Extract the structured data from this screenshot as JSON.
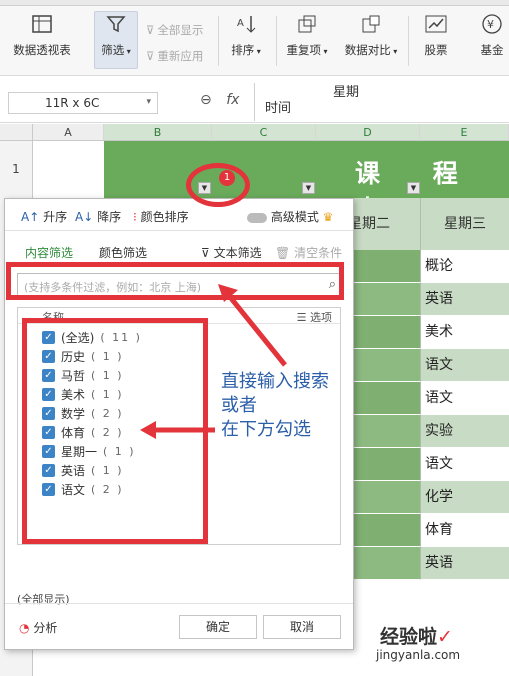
{
  "ribbon": {
    "pivot_label": "数据透视表",
    "filter_label": "筛选",
    "show_all_label": "全部显示",
    "reapply_label": "重新应用",
    "sort_label": "排序",
    "duplicates_label": "重复项",
    "compare_label": "数据对比",
    "stock_label": "股票",
    "fund_label": "基金"
  },
  "formula_bar": {
    "name_box": "11R x 6C",
    "fx_symbol": "fx",
    "content_line1": "星期",
    "content_line2": "时间"
  },
  "columns": [
    "A",
    "B",
    "C",
    "D",
    "E"
  ],
  "rows": [
    "1"
  ],
  "sheet": {
    "title": "课 程 表",
    "header_col_d": "星期二",
    "header_col_e": "星期三",
    "col_e_values": [
      "概论",
      "英语",
      "美术",
      "语文",
      "语文",
      "实验",
      "语文",
      "化学",
      "体育",
      "英语"
    ]
  },
  "panel": {
    "sort_asc": "升序",
    "sort_desc": "降序",
    "color_sort": "颜色排序",
    "advanced_mode": "高级模式",
    "tab_content": "内容筛选",
    "tab_color": "颜色筛选",
    "text_filter": "文本筛选",
    "clear_conditions": "清空条件",
    "search_placeholder": "(支持多条件过滤，例如：北京 上海)",
    "list_header_name": "名称",
    "list_header_options": "选项",
    "items": [
      {
        "label": "(全选)",
        "count": "( 11 )"
      },
      {
        "label": "历史",
        "count": "( 1 )"
      },
      {
        "label": "马哲",
        "count": "( 1 )"
      },
      {
        "label": "美术",
        "count": "( 1 )"
      },
      {
        "label": "数学",
        "count": "( 2 )"
      },
      {
        "label": "体育",
        "count": "( 2 )"
      },
      {
        "label": "星期一",
        "count": "( 1 )"
      },
      {
        "label": "英语",
        "count": "( 1 )"
      },
      {
        "label": "语文",
        "count": "( 2 )"
      }
    ],
    "show_all_status": "(全部显示)",
    "analysis": "分析",
    "ok": "确定",
    "cancel": "取消"
  },
  "annotation": {
    "badge": "1",
    "line1": "直接输入搜索",
    "line2": "或者",
    "line3": "在下方勾选"
  },
  "watermark": {
    "main": "经验啦",
    "sub": "jingyanla.com"
  },
  "colors": {
    "accent_green": "#6aaa5b",
    "light_green": "#c8dbc4",
    "annotation_red": "#e2343a",
    "annotation_blue": "#2b5fa8"
  }
}
